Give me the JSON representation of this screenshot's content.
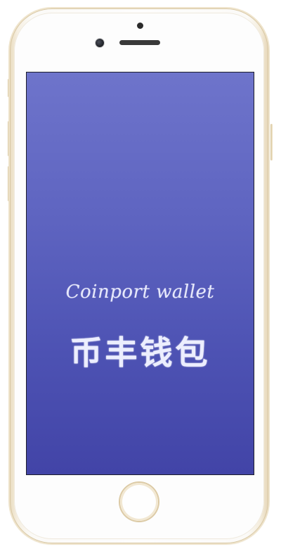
{
  "splash": {
    "subtitle": "Coinport wallet",
    "title": "币丰钱包"
  },
  "colors": {
    "screen_top": "#6e74cb",
    "screen_bottom": "#4244a7",
    "phone_rim": "#e6d6b8",
    "text": "#eceefe"
  },
  "icons": {
    "home_button": "home-button-icon",
    "front_camera": "front-camera-icon",
    "earpiece": "earpiece-speaker-icon"
  }
}
